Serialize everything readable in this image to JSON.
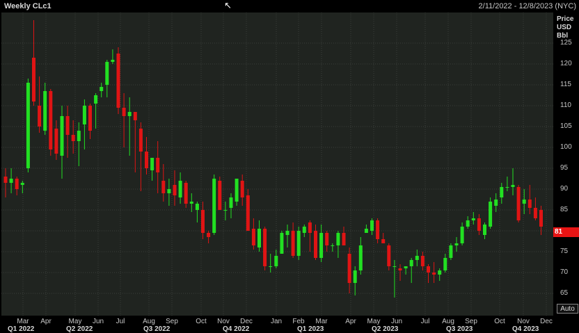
{
  "header": {
    "title": "Weekly CLc1",
    "range": "2/11/2022 - 12/8/2023 (NYC)"
  },
  "axis": {
    "title_lines": [
      "Price",
      "USD",
      "Bbl"
    ],
    "auto_label": "Auto",
    "last_label": "81"
  },
  "colors": {
    "up": "#22e022",
    "down": "#e01414",
    "background": "#202420",
    "grid": "#3a3e3a"
  },
  "month_labels": [
    "Mar",
    "Apr",
    "May",
    "Jun",
    "Jul",
    "Aug",
    "Sep",
    "Oct",
    "Nov",
    "Dec",
    "Jan",
    "Feb",
    "Mar",
    "Apr",
    "May",
    "Jun",
    "Jul",
    "Aug",
    "Sep",
    "Oct",
    "Nov",
    "Dec"
  ],
  "quarter_labels": [
    "Q1 2022",
    "Q2 2022",
    "Q3 2022",
    "Q4 2022",
    "Q1 2023",
    "Q2 2023",
    "Q3 2023",
    "Q4 2023"
  ],
  "chart_data": {
    "type": "candlestick",
    "title": "Weekly CLc1",
    "ylabel": "Price USD Bbl",
    "ylim": [
      61,
      133
    ],
    "yticks": [
      65,
      70,
      75,
      80,
      85,
      90,
      95,
      100,
      105,
      110,
      115,
      120,
      125
    ],
    "grid": true,
    "last_price": 81,
    "candles": [
      [
        93.0,
        95.0,
        88.0,
        91.5
      ],
      [
        91.5,
        95.0,
        89.0,
        92.5
      ],
      [
        92.5,
        93.0,
        88.5,
        90.0
      ],
      [
        91.0,
        92.0,
        89.0,
        91.5
      ],
      [
        95.0,
        116.5,
        94.0,
        115.5
      ],
      [
        121.5,
        130.5,
        110.0,
        111.0
      ],
      [
        110.0,
        117.0,
        103.5,
        105.0
      ],
      [
        104.0,
        115.5,
        103.0,
        113.5
      ],
      [
        113.5,
        114.0,
        98.0,
        99.5
      ],
      [
        104.5,
        106.5,
        97.0,
        98.5
      ],
      [
        98.0,
        110.0,
        92.5,
        107.5
      ],
      [
        107.5,
        110.0,
        97.5,
        103.0
      ],
      [
        103.0,
        106.5,
        98.5,
        101.5
      ],
      [
        101.5,
        106.0,
        95.5,
        104.0
      ],
      [
        105.5,
        111.5,
        99.5,
        110.0
      ],
      [
        110.0,
        110.5,
        102.0,
        104.0
      ],
      [
        110.5,
        113.0,
        104.5,
        112.5
      ],
      [
        113.5,
        115.5,
        112.0,
        114.5
      ],
      [
        115.0,
        121.0,
        112.0,
        120.5
      ],
      [
        120.5,
        123.5,
        120.0,
        121.0
      ],
      [
        122.5,
        124.0,
        108.0,
        109.5
      ],
      [
        109.5,
        113.0,
        100.0,
        107.5
      ],
      [
        107.5,
        112.0,
        98.0,
        108.5
      ],
      [
        108.5,
        108.5,
        94.0,
        106.5
      ],
      [
        104.5,
        106.0,
        89.5,
        99.0
      ],
      [
        99.0,
        102.5,
        93.5,
        95.0
      ],
      [
        94.5,
        97.5,
        92.0,
        97.5
      ],
      [
        97.5,
        101.5,
        89.0,
        94.0
      ],
      [
        92.0,
        96.0,
        87.0,
        89.0
      ],
      [
        89.0,
        92.5,
        86.0,
        90.0
      ],
      [
        91.0,
        94.5,
        86.0,
        88.5
      ],
      [
        88.0,
        94.0,
        86.5,
        92.0
      ],
      [
        91.5,
        92.0,
        85.5,
        86.5
      ],
      [
        86.5,
        89.0,
        84.5,
        87.0
      ],
      [
        85.0,
        87.0,
        82.0,
        86.5
      ],
      [
        85.0,
        87.0,
        78.0,
        79.5
      ],
      [
        79.5,
        80.0,
        77.0,
        78.5
      ],
      [
        79.5,
        93.5,
        79.0,
        92.5
      ],
      [
        92.0,
        93.0,
        85.0,
        85.0
      ],
      [
        85.0,
        87.0,
        82.5,
        85.0
      ],
      [
        85.5,
        89.0,
        83.0,
        88.0
      ],
      [
        87.0,
        92.5,
        86.0,
        92.5
      ],
      [
        92.0,
        93.5,
        86.0,
        88.0
      ],
      [
        88.5,
        90.0,
        80.0,
        80.0
      ],
      [
        80.5,
        83.0,
        75.5,
        76.5
      ],
      [
        76.0,
        82.5,
        75.0,
        80.5
      ],
      [
        80.5,
        81.0,
        70.5,
        71.5
      ],
      [
        71.5,
        74.5,
        70.0,
        71.5
      ],
      [
        71.5,
        75.5,
        71.0,
        74.0
      ],
      [
        74.5,
        80.0,
        74.5,
        79.5
      ],
      [
        79.0,
        81.5,
        76.0,
        80.0
      ],
      [
        80.0,
        82.0,
        73.5,
        74.0
      ],
      [
        74.0,
        81.0,
        73.0,
        80.0
      ],
      [
        79.5,
        81.5,
        78.5,
        81.0
      ],
      [
        82.0,
        82.5,
        75.0,
        79.5
      ],
      [
        80.0,
        81.5,
        73.0,
        73.5
      ],
      [
        73.5,
        81.5,
        72.5,
        79.5
      ],
      [
        79.5,
        80.0,
        75.0,
        76.5
      ],
      [
        76.5,
        77.0,
        75.0,
        76.5
      ],
      [
        76.5,
        80.0,
        73.5,
        79.5
      ],
      [
        79.5,
        81.0,
        76.5,
        76.5
      ],
      [
        74.5,
        76.0,
        65.0,
        67.5
      ],
      [
        67.5,
        71.5,
        64.5,
        70.5
      ],
      [
        70.5,
        78.5,
        69.5,
        76.5
      ],
      [
        79.5,
        81.5,
        79.5,
        80.5
      ],
      [
        80.0,
        83.0,
        79.0,
        82.5
      ],
      [
        82.5,
        83.0,
        77.0,
        78.0
      ],
      [
        78.0,
        79.5,
        77.0,
        77.0
      ],
      [
        76.5,
        77.0,
        70.5,
        71.5
      ],
      [
        71.5,
        73.0,
        64.0,
        71.5
      ],
      [
        71.0,
        72.0,
        68.0,
        70.5
      ],
      [
        71.0,
        71.5,
        69.5,
        71.5
      ],
      [
        71.5,
        73.5,
        67.5,
        73.0
      ],
      [
        73.0,
        75.5,
        71.5,
        74.0
      ],
      [
        74.0,
        75.0,
        70.5,
        71.5
      ],
      [
        71.5,
        72.0,
        67.5,
        70.0
      ],
      [
        70.0,
        72.5,
        67.5,
        69.5
      ],
      [
        69.5,
        71.0,
        68.0,
        70.5
      ],
      [
        70.5,
        74.5,
        70.0,
        73.5
      ],
      [
        73.5,
        77.0,
        73.0,
        76.5
      ],
      [
        76.5,
        78.5,
        75.0,
        77.0
      ],
      [
        77.0,
        82.0,
        76.5,
        81.0
      ],
      [
        81.0,
        83.5,
        80.5,
        82.5
      ],
      [
        82.5,
        84.5,
        81.5,
        83.0
      ],
      [
        83.0,
        84.0,
        79.0,
        80.0
      ],
      [
        79.0,
        82.0,
        78.0,
        81.5
      ],
      [
        81.0,
        88.0,
        80.5,
        87.0
      ],
      [
        86.0,
        89.0,
        84.5,
        87.5
      ],
      [
        88.0,
        91.5,
        86.5,
        90.5
      ],
      [
        90.5,
        93.0,
        89.5,
        90.5
      ],
      [
        90.5,
        95.0,
        88.5,
        91.0
      ],
      [
        90.5,
        91.0,
        82.0,
        82.5
      ],
      [
        86.5,
        90.0,
        84.0,
        87.5
      ],
      [
        87.5,
        91.0,
        84.0,
        85.5
      ],
      [
        85.5,
        88.0,
        82.5,
        83.0
      ],
      [
        85.0,
        86.0,
        79.0,
        81.0
      ]
    ]
  }
}
